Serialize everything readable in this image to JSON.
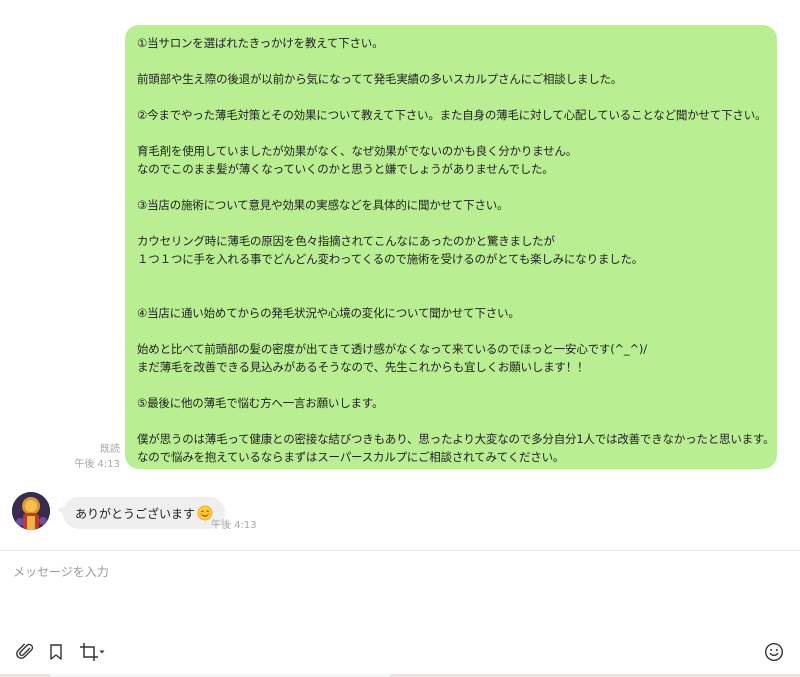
{
  "conversation": {
    "outgoing": {
      "lines": [
        "①当サロンを選ばれたきっかけを教えて下さい。",
        "",
        "前頭部や生え際の後退が以前から気になってて発毛実績の多いスカルプさんにご相談しました。",
        "",
        "②今までやった薄毛対策とその効果について教えて下さい。また自身の薄毛に対して心配していることなど聞かせて下さい。",
        "",
        "育毛剤を使用していましたが効果がなく、なぜ効果がでないのかも良く分かりません。",
        "なのでこのまま髪が薄くなっていくのかと思うと嫌でしょうがありませんでした。",
        "",
        "③当店の施術について意見や効果の実感などを具体的に聞かせて下さい。",
        "",
        "カウセリング時に薄毛の原因を色々指摘されてこんなにあったのかと驚きましたが",
        "１つ１つに手を入れる事でどんどん変わってくるので施術を受けるのがとても楽しみになりました。",
        "",
        "",
        "④当店に通い始めてからの発毛状況や心境の変化について聞かせて下さい。",
        "",
        "始めと比べて前頭部の髪の密度が出てきて透け感がなくなって来ているのでほっと一安心です(^_^)/",
        "まだ薄毛を改善できる見込みがあるそうなので、先生これからも宜しくお願いします！！",
        "",
        "⑤最後に他の薄毛で悩む方へ一言お願いします。",
        "",
        "僕が思うのは薄毛って健康との密接な結びつきもあり、思ったより大変なので多分自分1人では改善できなかったと思います。",
        "なので悩みを抱えているならまずはスーパースカルプにご相談されてみてください。"
      ],
      "read_label": "既読",
      "time": "午後 4:13"
    },
    "incoming": {
      "text": "ありがとうございます",
      "emoji_icon": "smiling-face-emoji",
      "time": "午後 4:13"
    }
  },
  "composer": {
    "placeholder": "メッセージを入力",
    "tools": [
      "paperclip-icon",
      "bookmark-icon",
      "crop-icon",
      "emoji-icon"
    ]
  },
  "colors": {
    "outgoing_bubble": "#b9ee93",
    "incoming_bubble": "#efefef",
    "meta_text": "#a7a7a7"
  }
}
